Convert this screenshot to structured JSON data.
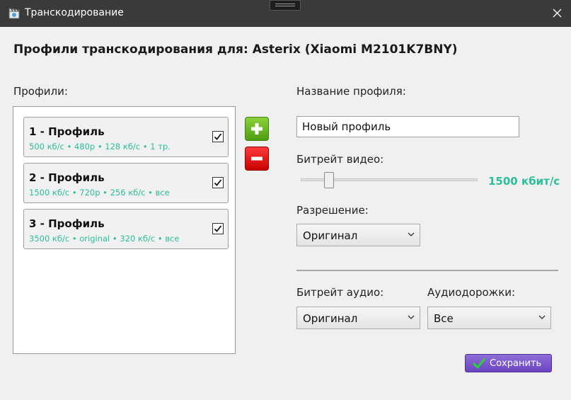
{
  "window": {
    "title": "Транскодирование"
  },
  "heading": "Профили транскодирования для: Asterix (Xiaomi M2101K7BNY)",
  "profiles": {
    "label": "Профили:",
    "items": [
      {
        "name": "1 - Профиль",
        "details": "500 кб/с • 480p • 128 кб/с • 1 тр.",
        "checked": true
      },
      {
        "name": "2 - Профиль",
        "details": "1500 кб/с • 720p • 256 кб/с • все",
        "checked": true
      },
      {
        "name": "3 - Профиль",
        "details": "3500 кб/с • original • 320 кб/с • все",
        "checked": true
      }
    ]
  },
  "form": {
    "profile_name_label": "Название профиля:",
    "profile_name_value": "Новый профиль",
    "video_bitrate_label": "Битрейт видео:",
    "video_bitrate_value": "1500 кбит/с",
    "video_bitrate_slider_fraction": 0.14,
    "resolution_label": "Разрешение:",
    "resolution_value": "Оригинал",
    "audio_bitrate_label": "Битрейт аудио:",
    "audio_bitrate_value": "Оригинал",
    "audio_tracks_label": "Аудиодорожки:",
    "audio_tracks_value": "Все"
  },
  "actions": {
    "save_label": "Сохранить"
  },
  "colors": {
    "accent_teal": "#2bbf9a",
    "add_green": "#6cbf21",
    "remove_red": "#e00000",
    "save_purple": "#7b57cc",
    "titlebar": "#3a3a3a"
  },
  "icons": {
    "app": "clapperboard-icon",
    "close": "close-icon",
    "add": "plus-icon",
    "remove": "minus-icon",
    "check": "checkmark-icon",
    "dropdown": "chevron-down-icon"
  }
}
